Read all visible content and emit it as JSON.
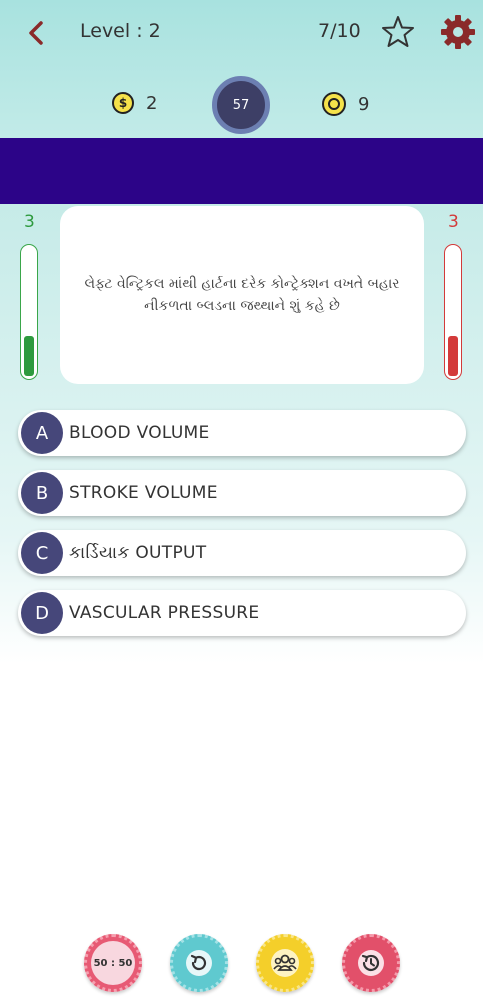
{
  "header": {
    "level_label": "Level : 2",
    "progress": "7/10"
  },
  "stats": {
    "coins": "2",
    "timer": "57",
    "tokens": "9",
    "coin_symbol": "$"
  },
  "scores": {
    "correct": "3",
    "wrong": "3",
    "correct_level": 0.3,
    "wrong_level": 0.3
  },
  "question": {
    "text": "લેફ્ટ વેન્ટ્રિકલ માંથી હાર્ટના દરેક કોન્ટ્રેક્શન વખતે બહાર નીકળતા બ્લડના જથ્થાને શું કહે છે"
  },
  "options": [
    {
      "letter": "A",
      "text": "BLOOD VOLUME"
    },
    {
      "letter": "B",
      "text": "STROKE VOLUME"
    },
    {
      "letter": "C",
      "text": "કાર્ડિયાક OUTPUT"
    },
    {
      "letter": "D",
      "text": "VASCULAR PRESSURE"
    }
  ],
  "powerups": {
    "fifty_fifty_label": "50 : 50"
  },
  "colors": {
    "accent_band": "#2c0488",
    "option_badge": "#46477a",
    "correct": "#2e9a3e",
    "wrong": "#d33a3a"
  }
}
